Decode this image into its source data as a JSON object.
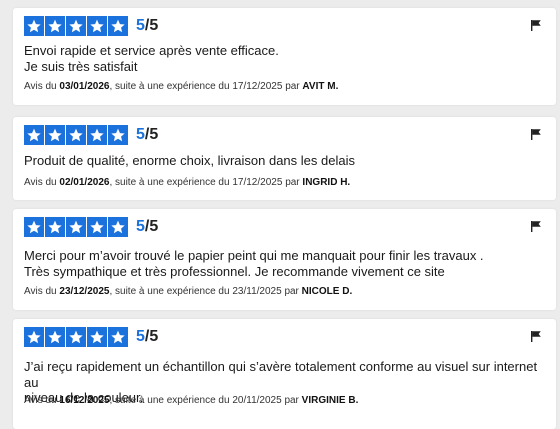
{
  "colors": {
    "star_bg": "#1b72dd",
    "score": "#1b72dd",
    "page_bg": "#ececec"
  },
  "icons": {
    "star": "star-icon",
    "flag": "flag-icon"
  },
  "labels": {
    "avis_du": "Avis du",
    "suite": ", suite à une expérience du",
    "par": "par"
  },
  "reviews": [
    {
      "rating": 5,
      "score": "5",
      "max": "/5",
      "lines": [
        "Envoi rapide et service après vente efficace.",
        "Je suis très satisfait"
      ],
      "review_date": "03/01/2026",
      "experience_date": "17/12/2025",
      "author": "AVIT M."
    },
    {
      "rating": 5,
      "score": "5",
      "max": "/5",
      "lines": [
        "Produit de qualité,  enorme choix, livraison dans les delais"
      ],
      "review_date": "02/01/2026",
      "experience_date": "17/12/2025",
      "author": "INGRID H."
    },
    {
      "rating": 5,
      "score": "5",
      "max": "/5",
      "lines": [
        "Merci pour m’avoir trouvé le papier peint qui me manquait pour finir les travaux .",
        "Très sympathique et très professionnel.  Je recommande vivement ce site"
      ],
      "review_date": "23/12/2025",
      "experience_date": "23/11/2025",
      "author": "NICOLE D."
    },
    {
      "rating": 5,
      "score": "5",
      "max": "/5",
      "lines": [
        "J’ai reçu rapidement un échantillon qui s’avère totalement conforme au visuel sur internet au",
        "niveau de la couleur."
      ],
      "review_date": "16/12/2025",
      "experience_date": "20/11/2025",
      "author": "VIRGINIE B."
    }
  ]
}
